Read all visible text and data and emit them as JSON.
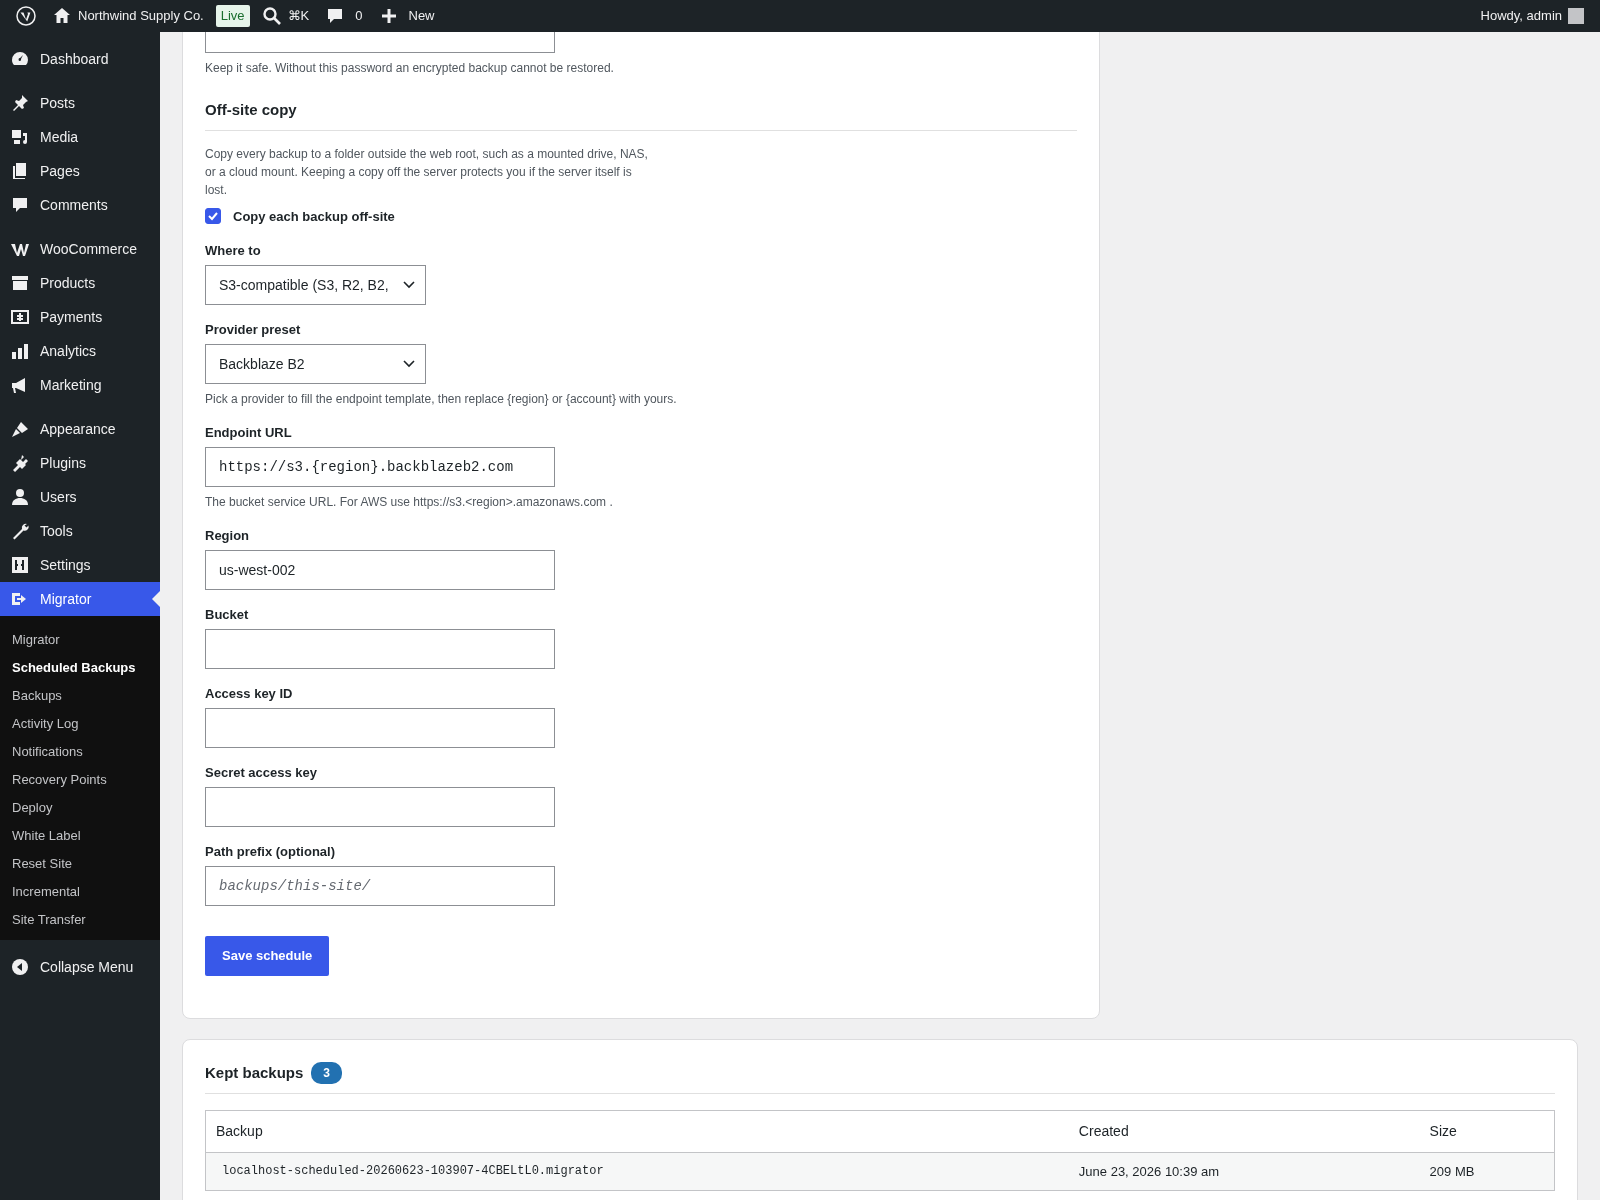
{
  "admin_bar": {
    "site_name": "Northwind Supply Co.",
    "env_badge": "Live",
    "search_shortcut": "⌘K",
    "comments_count": "0",
    "new_label": "New",
    "greeting": "Howdy, admin"
  },
  "sidebar": {
    "groups": [
      {
        "items": [
          {
            "label": "Dashboard",
            "selected": false
          }
        ]
      },
      {
        "items": [
          {
            "label": "Posts",
            "selected": false
          },
          {
            "label": "Media",
            "selected": false
          },
          {
            "label": "Pages",
            "selected": false
          },
          {
            "label": "Comments",
            "selected": false
          }
        ]
      },
      {
        "items": [
          {
            "label": "WooCommerce",
            "selected": false
          },
          {
            "label": "Products",
            "selected": false
          },
          {
            "label": "Payments",
            "selected": false
          },
          {
            "label": "Analytics",
            "selected": false
          },
          {
            "label": "Marketing",
            "selected": false
          }
        ]
      },
      {
        "items": [
          {
            "label": "Appearance",
            "selected": false
          },
          {
            "label": "Plugins",
            "selected": false
          },
          {
            "label": "Users",
            "selected": false
          },
          {
            "label": "Tools",
            "selected": false
          },
          {
            "label": "Settings",
            "selected": false
          },
          {
            "label": "Migrator",
            "selected": true,
            "children": [
              {
                "label": "Migrator",
                "selected": false
              },
              {
                "label": "Scheduled Backups",
                "selected": true
              },
              {
                "label": "Backups",
                "selected": false
              },
              {
                "label": "Activity Log",
                "selected": false
              },
              {
                "label": "Notifications",
                "selected": false
              },
              {
                "label": "Recovery Points",
                "selected": false
              },
              {
                "label": "Deploy",
                "selected": false
              },
              {
                "label": "White Label",
                "selected": false
              },
              {
                "label": "Reset Site",
                "selected": false
              },
              {
                "label": "Incremental",
                "selected": false
              },
              {
                "label": "Site Transfer",
                "selected": false
              }
            ]
          }
        ]
      }
    ],
    "collapse_label": "Collapse Menu"
  },
  "settings_card": {
    "password_help": "Keep it safe. Without this password an encrypted backup cannot be restored.",
    "section_title": "Off-site copy",
    "section_description": "Copy every backup to a folder outside the web root, such as a mounted drive, NAS, or a cloud mount. Keeping a copy off the server protects you if the server itself is lost.",
    "fields": [
      {
        "kind": "checkbox",
        "label": "Copy each backup off-site",
        "checked": true
      },
      {
        "kind": "select",
        "label": "Where to",
        "value": "S3-compatible (S3, R2, B2,"
      },
      {
        "kind": "select",
        "label": "Provider preset",
        "value": "Backblaze B2",
        "help": "Pick a provider to fill the endpoint template, then replace {region} or {account} with yours."
      },
      {
        "kind": "input",
        "label": "Endpoint URL",
        "value": "https://s3.{region}.backblazeb2.com",
        "monospace": true,
        "help": "The bucket service URL. For AWS use https://s3.<region>.amazonaws.com ."
      },
      {
        "kind": "input",
        "label": "Region",
        "value": "us-west-002"
      },
      {
        "kind": "input",
        "label": "Bucket"
      },
      {
        "kind": "input",
        "label": "Access key ID"
      },
      {
        "kind": "input",
        "label": "Secret access key"
      },
      {
        "kind": "input",
        "label": "Path prefix (optional)",
        "placeholder": "backups/this-site/",
        "monospace": true
      }
    ],
    "save_button": "Save schedule"
  },
  "backups_card": {
    "title": "Kept backups",
    "count": "3",
    "table": {
      "columns": [
        "Backup",
        "Created",
        "Size"
      ],
      "rows": [
        [
          "localhost-scheduled-20260623-103907-4CBELtL0.migrator",
          "June 23, 2026 10:39 am",
          "209 MB"
        ]
      ]
    }
  }
}
